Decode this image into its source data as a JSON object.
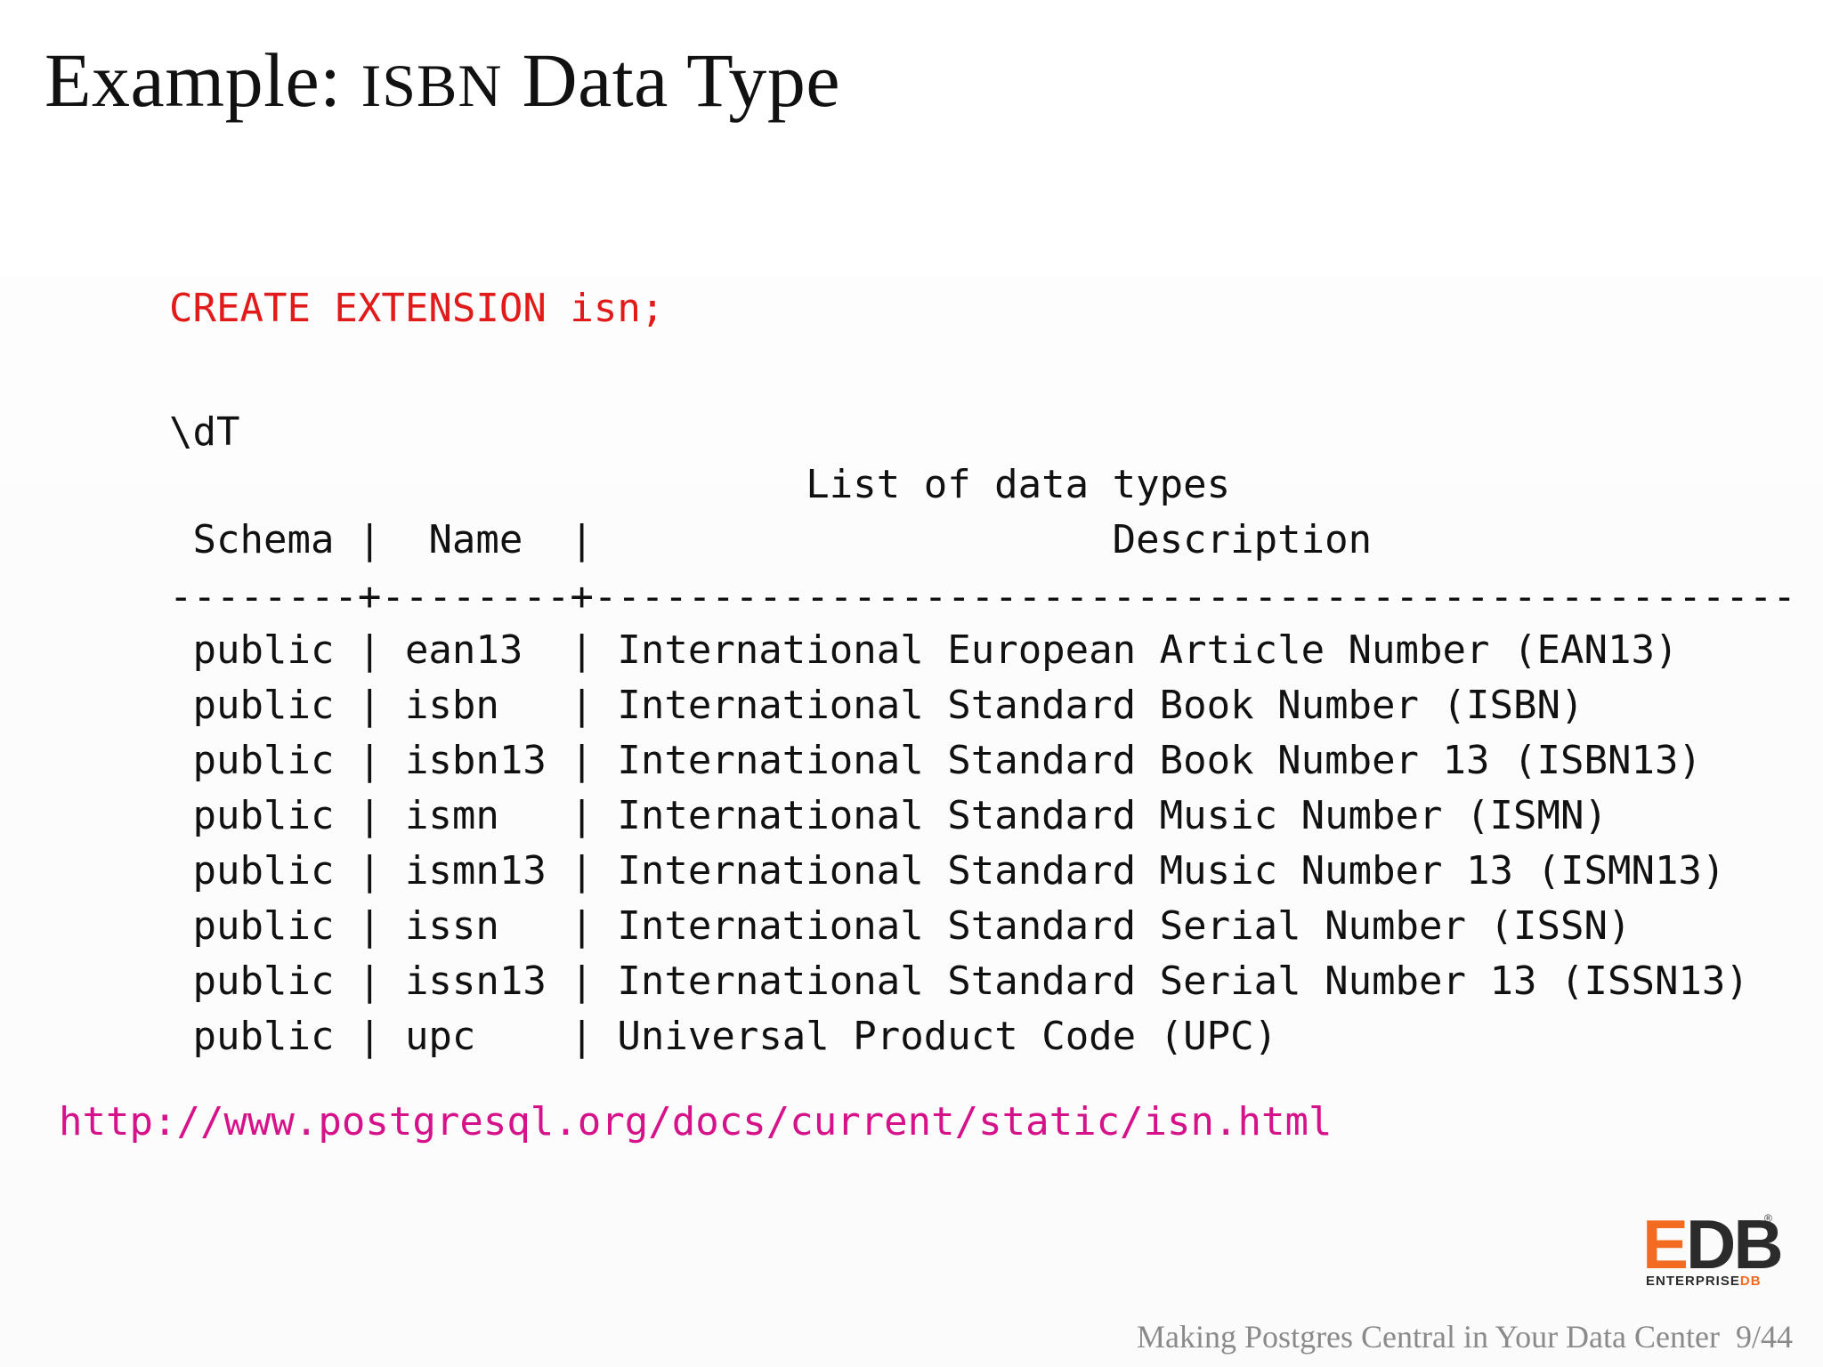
{
  "slide": {
    "title_prefix": "Example: ",
    "title_smallcaps": "ISBN",
    "title_suffix": " Data Type",
    "create_statement": "CREATE EXTENSION isn;",
    "psql_command": "\\dT",
    "table_title": "List of data types",
    "table_header": {
      "schema": "Schema",
      "name": "Name",
      "description": "Description"
    },
    "separator": "--------+--------+---------------------------------------------------",
    "rows": [
      {
        "schema": "public",
        "name": "ean13",
        "description": "International European Article Number (EAN13)"
      },
      {
        "schema": "public",
        "name": "isbn",
        "description": "International Standard Book Number (ISBN)"
      },
      {
        "schema": "public",
        "name": "isbn13",
        "description": "International Standard Book Number 13 (ISBN13)"
      },
      {
        "schema": "public",
        "name": "ismn",
        "description": "International Standard Music Number (ISMN)"
      },
      {
        "schema": "public",
        "name": "ismn13",
        "description": "International Standard Music Number 13 (ISMN13)"
      },
      {
        "schema": "public",
        "name": "issn",
        "description": "International Standard Serial Number (ISSN)"
      },
      {
        "schema": "public",
        "name": "issn13",
        "description": "International Standard Serial Number 13 (ISSN13)"
      },
      {
        "schema": "public",
        "name": "upc",
        "description": "Universal Product Code (UPC)"
      }
    ],
    "link": "http://www.postgresql.org/docs/current/static/isn.html"
  },
  "logo": {
    "mark_e": "E",
    "mark_db": "DB",
    "reg": "®",
    "sub_enterprise": "ENTERPRISE",
    "sub_db": "DB"
  },
  "footer": {
    "text": "Making Postgres Central in Your Data Center",
    "page": "9/44"
  },
  "colors": {
    "create_statement": "#e11a1a",
    "link": "#d6128a",
    "logo_orange": "#f26b21",
    "footer_gray": "#8a8a8a"
  }
}
